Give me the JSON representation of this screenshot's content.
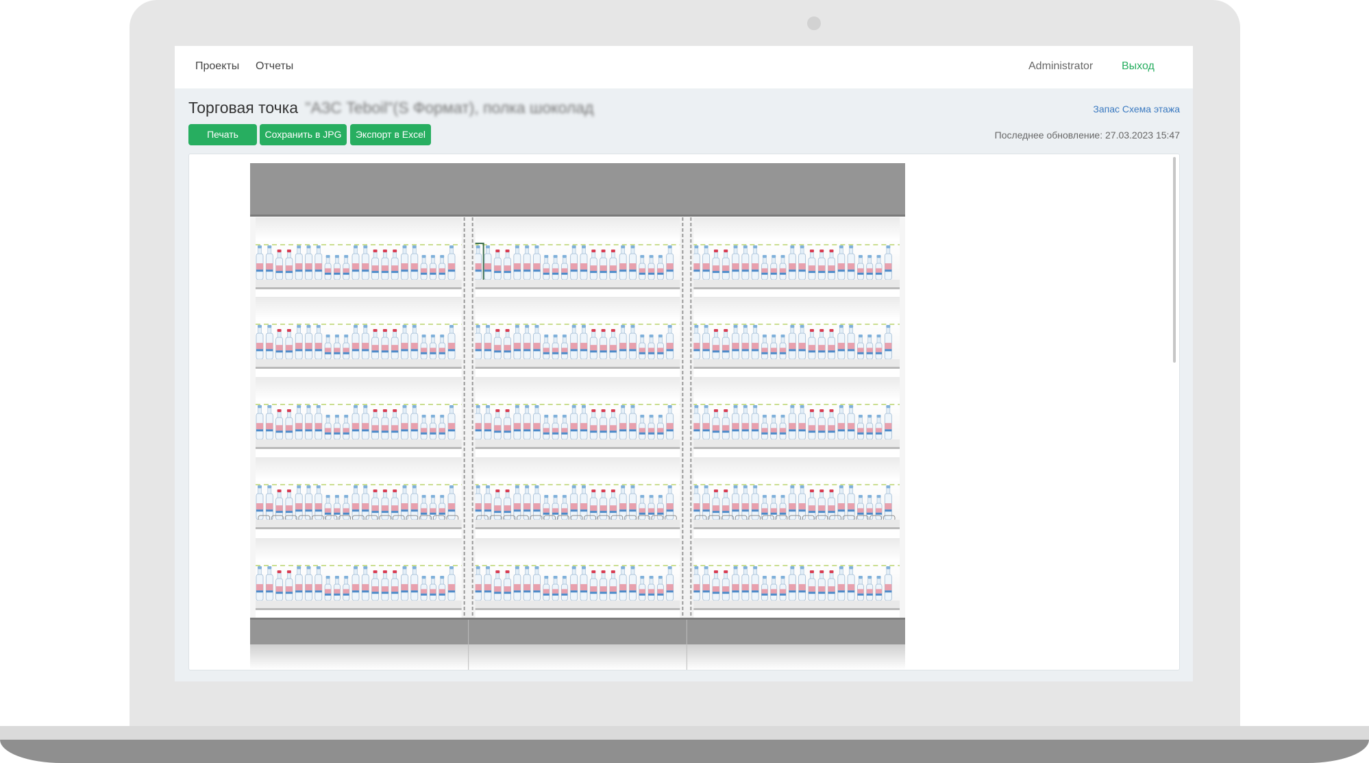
{
  "nav": {
    "projects": "Проекты",
    "reports": "Отчеты",
    "user": "Administrator",
    "logout": "Выход"
  },
  "header": {
    "title_prefix": "Торговая точка",
    "title_blurred": "\"АЗС Teboil\"(S Формат), полка шоколад",
    "floor_link": "Запас Схема этажа",
    "last_update": "Последнее обновление: 27.03.2023 15:47"
  },
  "toolbar": {
    "print": "Печать",
    "save_jpg": "Сохранить в JPG",
    "export_excel": "Экспорт в Excel"
  },
  "planogram": {
    "sections": 3,
    "shelves": 5,
    "product": "bottled-water",
    "selected": {
      "shelf": 1,
      "section": 2,
      "position": 1
    },
    "colors": {
      "accent": "#27ae60",
      "link": "#3a79c0",
      "header_panel": "#959595",
      "cap_red": "#d83c52",
      "cap_blue": "#7fb0da",
      "guide_line": "#b9d36a"
    }
  }
}
